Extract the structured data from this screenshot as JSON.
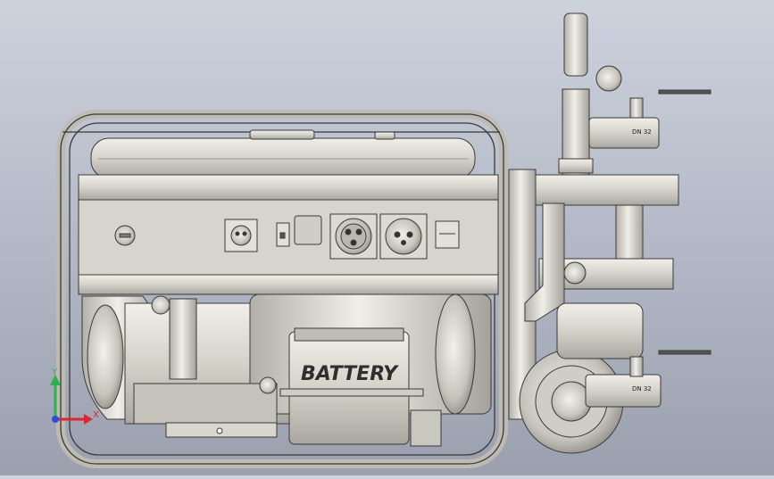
{
  "model": {
    "battery_label": "BATTERY",
    "valve_top_label": "DN\n32",
    "valve_bottom_label": "DN\n32"
  },
  "triad": {
    "x_label": "X",
    "y_label": "Y"
  },
  "colors": {
    "metal_light": "#e6e4dc",
    "metal_mid": "#c9c7be",
    "metal_dark": "#8f8d85",
    "outline": "#3a3a38",
    "axis_x": "#e0262b",
    "axis_y": "#2bb34a",
    "axis_z": "#2b4fd6"
  }
}
